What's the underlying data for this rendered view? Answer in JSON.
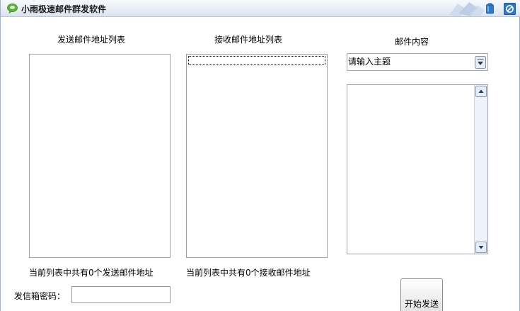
{
  "window": {
    "title": "小雨极速邮件群发软件"
  },
  "sender_panel": {
    "title": "发送邮件地址列表",
    "count_text": "当前列表中共有0个发送邮件地址"
  },
  "receiver_panel": {
    "title": "接收邮件地址列表",
    "count_text": "当前列表中共有0个接收邮件地址"
  },
  "content_panel": {
    "title": "邮件内容",
    "subject_value": "请输入主题"
  },
  "password": {
    "label": "发信箱密码："
  },
  "actions": {
    "send_label": "开始发送"
  },
  "icons": {
    "app": "chat-bubble-icon",
    "skin": "skin-icon",
    "close": "close-icon",
    "dropdown": "chevron-down-icon",
    "scroll_up": "arrow-up-icon",
    "scroll_down": "arrow-down-icon"
  },
  "colors": {
    "app_icon": "#5cb531",
    "title_buttons": "#2f78c9",
    "border": "#a0a0a0"
  }
}
